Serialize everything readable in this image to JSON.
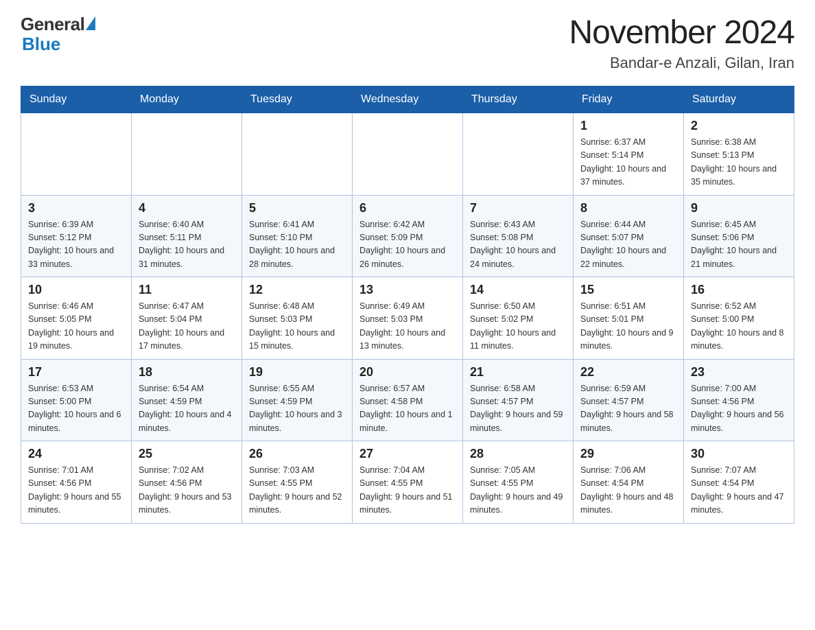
{
  "header": {
    "logo_general": "General",
    "logo_blue": "Blue",
    "month_title": "November 2024",
    "location": "Bandar-e Anzali, Gilan, Iran"
  },
  "weekdays": [
    "Sunday",
    "Monday",
    "Tuesday",
    "Wednesday",
    "Thursday",
    "Friday",
    "Saturday"
  ],
  "weeks": [
    [
      {
        "day": "",
        "info": ""
      },
      {
        "day": "",
        "info": ""
      },
      {
        "day": "",
        "info": ""
      },
      {
        "day": "",
        "info": ""
      },
      {
        "day": "",
        "info": ""
      },
      {
        "day": "1",
        "info": "Sunrise: 6:37 AM\nSunset: 5:14 PM\nDaylight: 10 hours and 37 minutes."
      },
      {
        "day": "2",
        "info": "Sunrise: 6:38 AM\nSunset: 5:13 PM\nDaylight: 10 hours and 35 minutes."
      }
    ],
    [
      {
        "day": "3",
        "info": "Sunrise: 6:39 AM\nSunset: 5:12 PM\nDaylight: 10 hours and 33 minutes."
      },
      {
        "day": "4",
        "info": "Sunrise: 6:40 AM\nSunset: 5:11 PM\nDaylight: 10 hours and 31 minutes."
      },
      {
        "day": "5",
        "info": "Sunrise: 6:41 AM\nSunset: 5:10 PM\nDaylight: 10 hours and 28 minutes."
      },
      {
        "day": "6",
        "info": "Sunrise: 6:42 AM\nSunset: 5:09 PM\nDaylight: 10 hours and 26 minutes."
      },
      {
        "day": "7",
        "info": "Sunrise: 6:43 AM\nSunset: 5:08 PM\nDaylight: 10 hours and 24 minutes."
      },
      {
        "day": "8",
        "info": "Sunrise: 6:44 AM\nSunset: 5:07 PM\nDaylight: 10 hours and 22 minutes."
      },
      {
        "day": "9",
        "info": "Sunrise: 6:45 AM\nSunset: 5:06 PM\nDaylight: 10 hours and 21 minutes."
      }
    ],
    [
      {
        "day": "10",
        "info": "Sunrise: 6:46 AM\nSunset: 5:05 PM\nDaylight: 10 hours and 19 minutes."
      },
      {
        "day": "11",
        "info": "Sunrise: 6:47 AM\nSunset: 5:04 PM\nDaylight: 10 hours and 17 minutes."
      },
      {
        "day": "12",
        "info": "Sunrise: 6:48 AM\nSunset: 5:03 PM\nDaylight: 10 hours and 15 minutes."
      },
      {
        "day": "13",
        "info": "Sunrise: 6:49 AM\nSunset: 5:03 PM\nDaylight: 10 hours and 13 minutes."
      },
      {
        "day": "14",
        "info": "Sunrise: 6:50 AM\nSunset: 5:02 PM\nDaylight: 10 hours and 11 minutes."
      },
      {
        "day": "15",
        "info": "Sunrise: 6:51 AM\nSunset: 5:01 PM\nDaylight: 10 hours and 9 minutes."
      },
      {
        "day": "16",
        "info": "Sunrise: 6:52 AM\nSunset: 5:00 PM\nDaylight: 10 hours and 8 minutes."
      }
    ],
    [
      {
        "day": "17",
        "info": "Sunrise: 6:53 AM\nSunset: 5:00 PM\nDaylight: 10 hours and 6 minutes."
      },
      {
        "day": "18",
        "info": "Sunrise: 6:54 AM\nSunset: 4:59 PM\nDaylight: 10 hours and 4 minutes."
      },
      {
        "day": "19",
        "info": "Sunrise: 6:55 AM\nSunset: 4:59 PM\nDaylight: 10 hours and 3 minutes."
      },
      {
        "day": "20",
        "info": "Sunrise: 6:57 AM\nSunset: 4:58 PM\nDaylight: 10 hours and 1 minute."
      },
      {
        "day": "21",
        "info": "Sunrise: 6:58 AM\nSunset: 4:57 PM\nDaylight: 9 hours and 59 minutes."
      },
      {
        "day": "22",
        "info": "Sunrise: 6:59 AM\nSunset: 4:57 PM\nDaylight: 9 hours and 58 minutes."
      },
      {
        "day": "23",
        "info": "Sunrise: 7:00 AM\nSunset: 4:56 PM\nDaylight: 9 hours and 56 minutes."
      }
    ],
    [
      {
        "day": "24",
        "info": "Sunrise: 7:01 AM\nSunset: 4:56 PM\nDaylight: 9 hours and 55 minutes."
      },
      {
        "day": "25",
        "info": "Sunrise: 7:02 AM\nSunset: 4:56 PM\nDaylight: 9 hours and 53 minutes."
      },
      {
        "day": "26",
        "info": "Sunrise: 7:03 AM\nSunset: 4:55 PM\nDaylight: 9 hours and 52 minutes."
      },
      {
        "day": "27",
        "info": "Sunrise: 7:04 AM\nSunset: 4:55 PM\nDaylight: 9 hours and 51 minutes."
      },
      {
        "day": "28",
        "info": "Sunrise: 7:05 AM\nSunset: 4:55 PM\nDaylight: 9 hours and 49 minutes."
      },
      {
        "day": "29",
        "info": "Sunrise: 7:06 AM\nSunset: 4:54 PM\nDaylight: 9 hours and 48 minutes."
      },
      {
        "day": "30",
        "info": "Sunrise: 7:07 AM\nSunset: 4:54 PM\nDaylight: 9 hours and 47 minutes."
      }
    ]
  ]
}
